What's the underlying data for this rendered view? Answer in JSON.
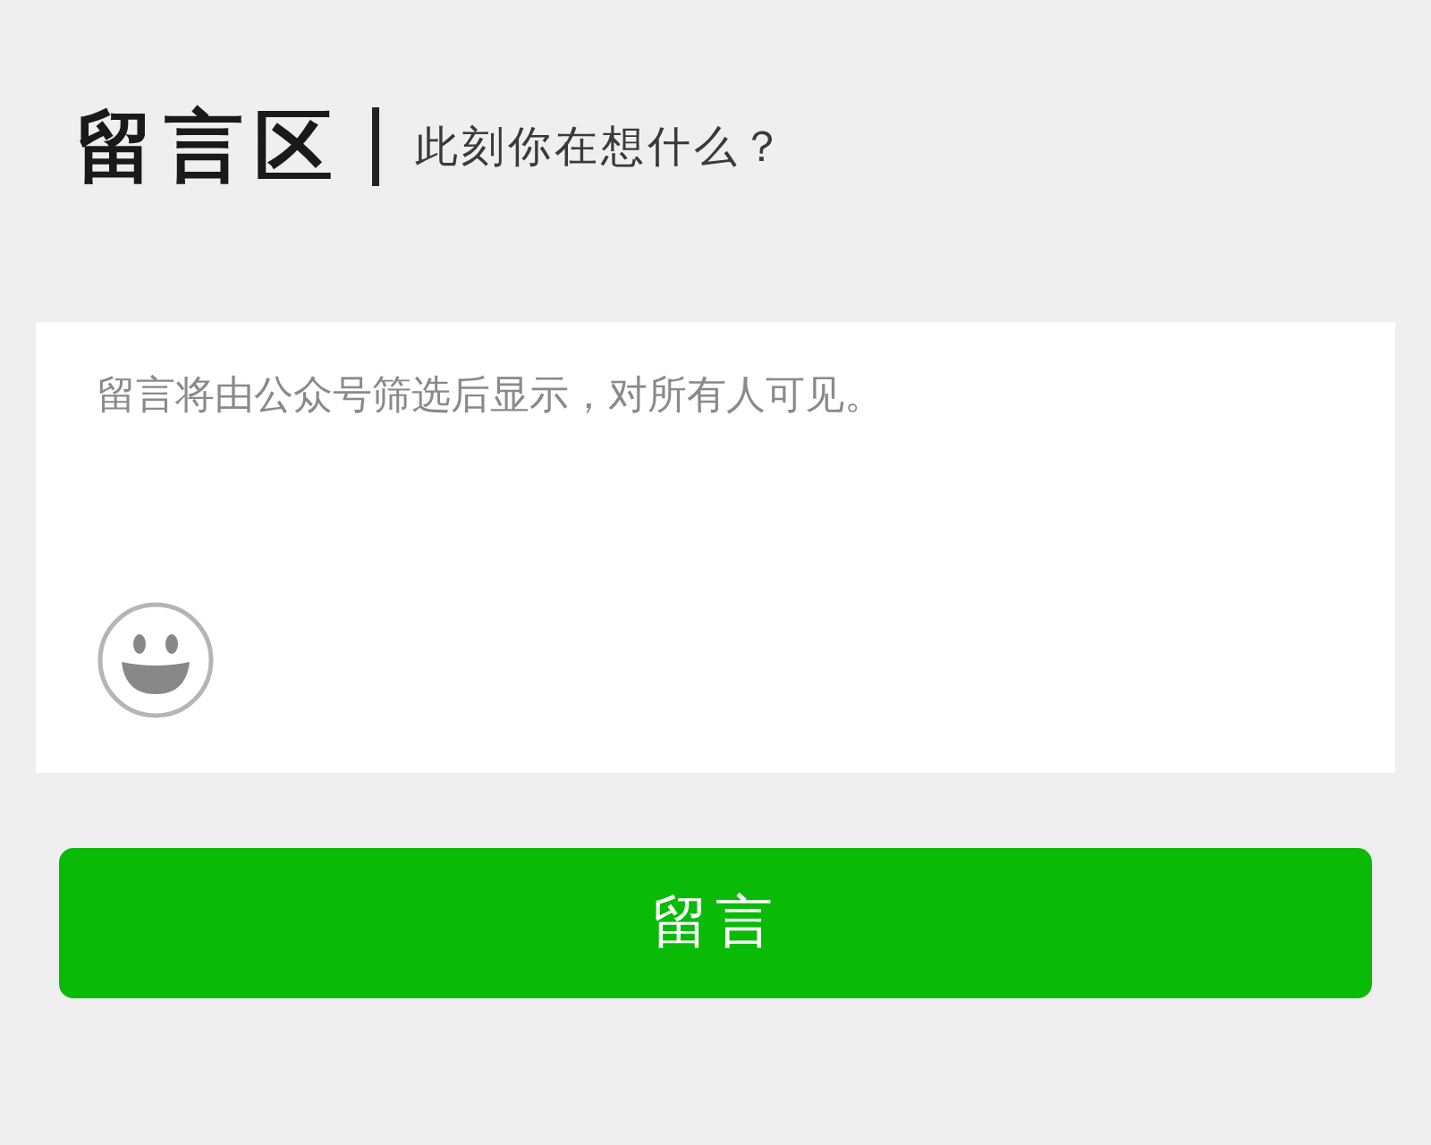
{
  "header": {
    "title": "留言区",
    "subtitle": "此刻你在想什么？"
  },
  "comment_box": {
    "placeholder": "留言将由公众号筛选后显示，对所有人可见。"
  },
  "submit_button": {
    "label": "留言"
  }
}
